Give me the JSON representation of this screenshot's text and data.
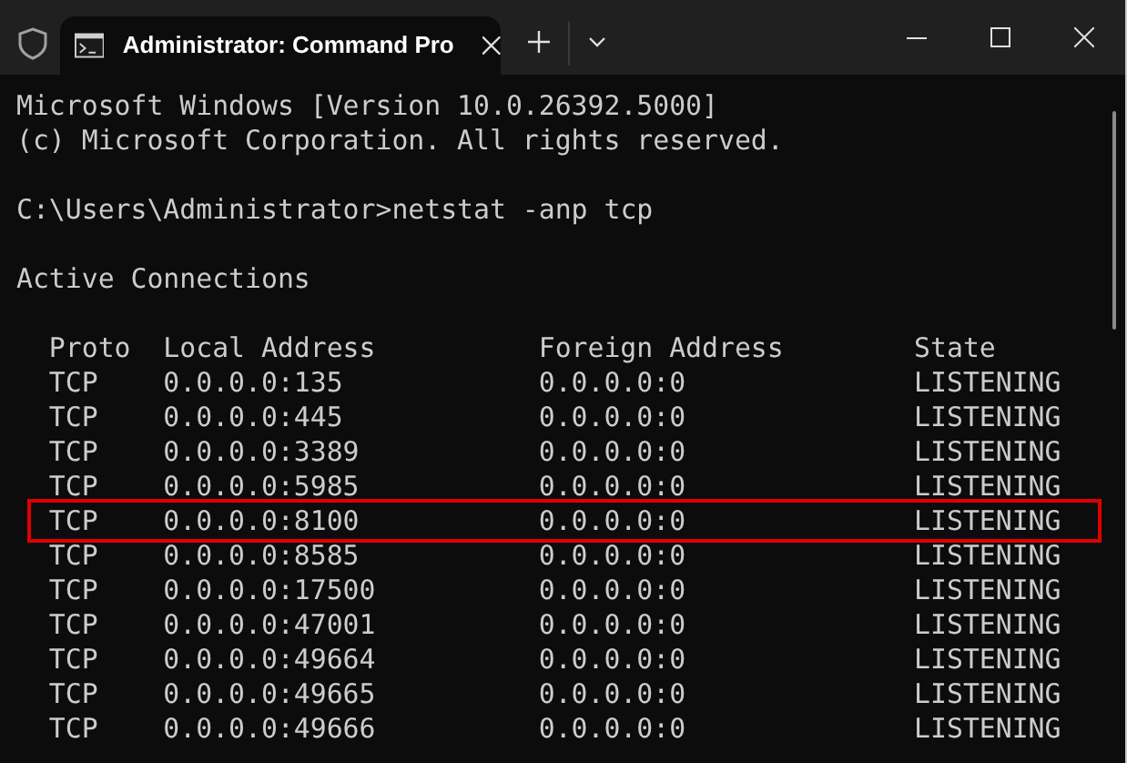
{
  "window": {
    "tabs": [
      {
        "title": "Administrator: Command Pro",
        "selected": true
      }
    ]
  },
  "terminal": {
    "blocks": [
      [
        "Microsoft Windows [Version 10.0.26392.5000]",
        "(c) Microsoft Corporation. All rights reserved."
      ],
      [
        "C:\\Users\\Administrator>netstat -anp tcp"
      ],
      [
        "Active Connections"
      ]
    ],
    "connections": {
      "columns": [
        "Proto",
        "Local Address",
        "Foreign Address",
        "State"
      ],
      "rows": [
        {
          "cells": [
            "TCP",
            "0.0.0.0:135",
            "0.0.0.0:0",
            "LISTENING"
          ],
          "highlighted": false
        },
        {
          "cells": [
            "TCP",
            "0.0.0.0:445",
            "0.0.0.0:0",
            "LISTENING"
          ],
          "highlighted": false
        },
        {
          "cells": [
            "TCP",
            "0.0.0.0:3389",
            "0.0.0.0:0",
            "LISTENING"
          ],
          "highlighted": false
        },
        {
          "cells": [
            "TCP",
            "0.0.0.0:5985",
            "0.0.0.0:0",
            "LISTENING"
          ],
          "highlighted": false
        },
        {
          "cells": [
            "TCP",
            "0.0.0.0:8100",
            "0.0.0.0:0",
            "LISTENING"
          ],
          "highlighted": true
        },
        {
          "cells": [
            "TCP",
            "0.0.0.0:8585",
            "0.0.0.0:0",
            "LISTENING"
          ],
          "highlighted": false
        },
        {
          "cells": [
            "TCP",
            "0.0.0.0:17500",
            "0.0.0.0:0",
            "LISTENING"
          ],
          "highlighted": false
        },
        {
          "cells": [
            "TCP",
            "0.0.0.0:47001",
            "0.0.0.0:0",
            "LISTENING"
          ],
          "highlighted": false
        },
        {
          "cells": [
            "TCP",
            "0.0.0.0:49664",
            "0.0.0.0:0",
            "LISTENING"
          ],
          "highlighted": false
        },
        {
          "cells": [
            "TCP",
            "0.0.0.0:49665",
            "0.0.0.0:0",
            "LISTENING"
          ],
          "highlighted": false
        },
        {
          "cells": [
            "TCP",
            "0.0.0.0:49666",
            "0.0.0.0:0",
            "LISTENING"
          ],
          "highlighted": false
        }
      ]
    }
  }
}
